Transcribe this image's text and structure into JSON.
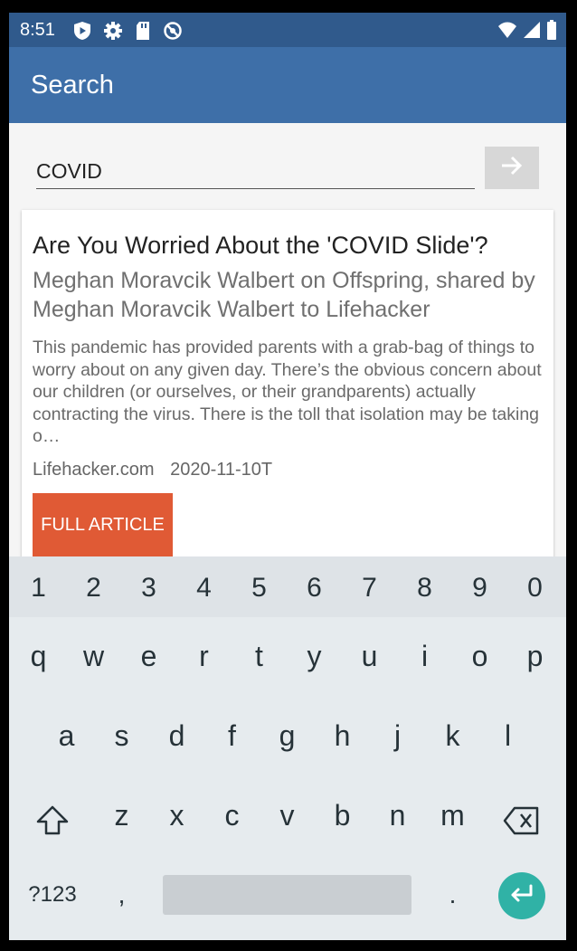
{
  "status_bar": {
    "time": "8:51",
    "left_icons": [
      "shield-play-icon",
      "gear-icon",
      "sd-card-icon",
      "no-sync-icon"
    ],
    "right_icons": [
      "wifi-icon",
      "signal-icon",
      "battery-icon"
    ]
  },
  "app_bar": {
    "title": "Search"
  },
  "search": {
    "query": "COVID",
    "submit_icon": "arrow-right-icon"
  },
  "article": {
    "title": "Are You Worried About the 'COVID Slide'?",
    "subtitle": "Meghan Moravcik Walbert on Offspring, shared by Meghan Moravcik Walbert to Lifehacker",
    "excerpt": "This pandemic has provided parents with a grab-bag of things to worry about on any given day. There’s the obvious concern about our children (or ourselves, or their grandparents) actually contracting the virus. There is the toll that isolation may be taking o…",
    "source": "Lifehacker.com",
    "date": "2020-11-10T",
    "button_label": "FULL ARTICLE"
  },
  "keyboard": {
    "number_row": [
      "1",
      "2",
      "3",
      "4",
      "5",
      "6",
      "7",
      "8",
      "9",
      "0"
    ],
    "row1": [
      "q",
      "w",
      "e",
      "r",
      "t",
      "y",
      "u",
      "i",
      "o",
      "p"
    ],
    "row2": [
      "a",
      "s",
      "d",
      "f",
      "g",
      "h",
      "j",
      "k",
      "l"
    ],
    "row3": [
      "z",
      "x",
      "c",
      "v",
      "b",
      "n",
      "m"
    ],
    "symbols_label": "?123",
    "comma": ",",
    "period": ".",
    "shift_icon": "shift-icon",
    "backspace_icon": "backspace-icon",
    "enter_icon": "enter-icon"
  },
  "colors": {
    "status_bar": "#305a8c",
    "app_bar": "#3e6fa8",
    "button": "#e05a35",
    "enter_key": "#30b2a6"
  }
}
